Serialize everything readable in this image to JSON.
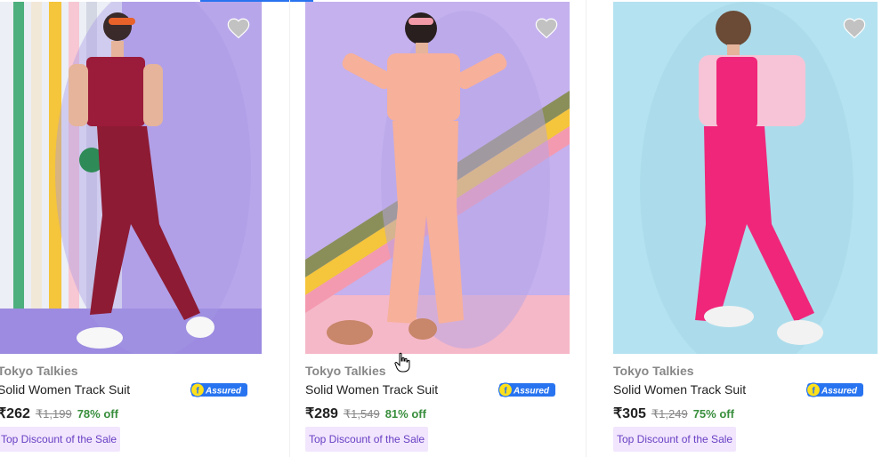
{
  "products": [
    {
      "brand": "Tokyo Talkies",
      "title": "Solid Women Track Suit",
      "price": "₹262",
      "mrp": "₹1,199",
      "discount": "78% off",
      "tag": "Top Discount of the Sale",
      "assured": "Assured",
      "image_icon": "product-image"
    },
    {
      "brand": "Tokyo Talkies",
      "title": "Solid Women Track Suit",
      "price": "₹289",
      "mrp": "₹1,549",
      "discount": "81% off",
      "tag": "Top Discount of the Sale",
      "assured": "Assured",
      "image_icon": "product-image"
    },
    {
      "brand": "Tokyo Talkies",
      "title": "Solid Women Track Suit",
      "price": "₹305",
      "mrp": "₹1,249",
      "discount": "75% off",
      "tag": "Top Discount of the Sale",
      "assured": "Assured",
      "image_icon": "product-image"
    }
  ],
  "colors": {
    "accent": "#2874f0",
    "discount_green": "#388e3c",
    "tag_bg": "#f1e6fd",
    "tag_text": "#6a3fc4",
    "wishlist_heart": "#c2c2c2"
  },
  "icons": {
    "wishlist": "heart-icon",
    "assured": "flipkart-assured-badge",
    "cursor": "hand-pointer-icon"
  }
}
